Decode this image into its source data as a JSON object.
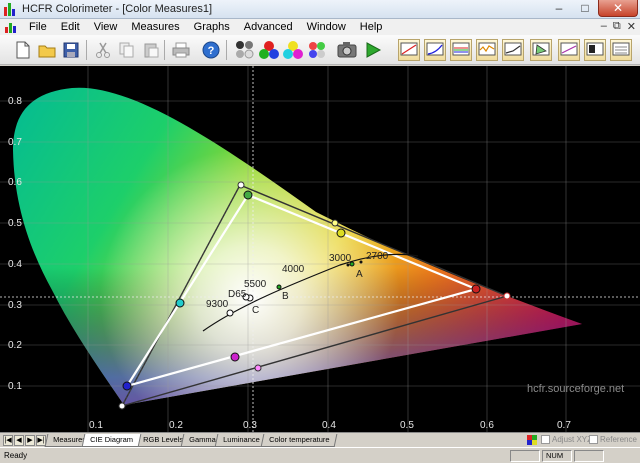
{
  "window": {
    "title": "HCFR Colorimeter - [Color Measures1]"
  },
  "menu": [
    "File",
    "Edit",
    "View",
    "Measures",
    "Graphs",
    "Advanced",
    "Window",
    "Help"
  ],
  "toolbar": {
    "buttons": [
      "new-document",
      "open-folder",
      "save",
      "cut",
      "copy",
      "paste",
      "print",
      "help",
      "measure-gray-scale",
      "measure-primaries",
      "measure-secondaries",
      "measure-saturations",
      "measure-all",
      "camera",
      "play"
    ],
    "graph_buttons": [
      "luminance-graph",
      "gamma-graph",
      "rgb-levels-graph",
      "color-temperature-graph",
      "near-black-graph",
      "cie-graph",
      "saturation-graph",
      "contrast-graph",
      "measures-graph"
    ]
  },
  "chart": {
    "x_ticks": [
      "0.1",
      "0.2",
      "0.3",
      "0.4",
      "0.5",
      "0.6",
      "0.7"
    ],
    "y_ticks": [
      "0.8",
      "0.7",
      "0.6",
      "0.5",
      "0.4",
      "0.3",
      "0.2",
      "0.1"
    ],
    "watermark": "hcfr.sourceforge.net",
    "cct_labels": [
      "2700",
      "3000",
      "4000",
      "5500",
      "9300",
      "D65"
    ],
    "illuminant_labels": [
      "A",
      "B",
      "C"
    ]
  },
  "tabs": [
    "Measures",
    "CIE Diagram",
    "RGB Levels",
    "Gamma",
    "Luminance",
    "Color temperature"
  ],
  "active_tab": "CIE Diagram",
  "options": {
    "adjust_xyz": "Adjust XYZ",
    "reference": "Reference"
  },
  "status": {
    "text": "Ready",
    "num": "NUM"
  }
}
